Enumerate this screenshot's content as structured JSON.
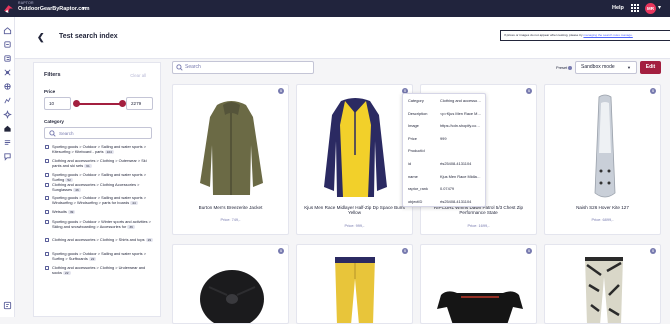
{
  "topbar": {
    "workspace_sub": "RAPTOR",
    "workspace_name": "OutdoorGearByRaptor.com",
    "help_label": "Help",
    "avatar_initials": "MR",
    "accent_color": "#a31f3f"
  },
  "sidebar": {
    "icons": [
      "home-icon",
      "layers-icon",
      "index-icon",
      "tools-icon",
      "merchandising-icon",
      "analytics-icon",
      "ai-icon",
      "shop-icon",
      "rules-icon",
      "chat-icon"
    ],
    "footer_icon": "help-icon"
  },
  "header": {
    "back_icon": "arrow-left-icon",
    "title": "Test search index",
    "notice_text": "If prices or images do not appear when testing, please try ",
    "notice_link": "managing the search rules manage."
  },
  "filters": {
    "title": "Filters",
    "clear_label": "Clear all",
    "price_label": "Price",
    "price_min": "10",
    "price_max": "2279",
    "category_label": "Category",
    "category_search_placeholder": "Search",
    "categories": [
      {
        "label": "Sporting goods > Outdoor > Sailing and water sports > Kitesurfing > Kiteboard - parts",
        "count": "104"
      },
      {
        "label": "Clothing and accessories > Clothing > Outerwear > Ski pants and ski sets",
        "count": "61"
      },
      {
        "label": "Sporting goods > Outdoor > Sailing and water sports > Surfing",
        "count": "52"
      },
      {
        "label": "Clothing and accessories > Clothing Accessories > Sunglasses",
        "count": "46"
      },
      {
        "label": "Sporting goods > Outdoor > Sailing and water sports > Windsurfing > Windsurfing > parts for boards",
        "count": "44"
      },
      {
        "label": "Wetsuits",
        "count": "39"
      },
      {
        "label": "Sporting goods > Outdoor > Winter sports and activities > Skiing and snowboarding > Accessories for",
        "count": "36"
      },
      {
        "label": "Clothing and accessories > Clothing > Shirts and tops",
        "count": "29"
      },
      {
        "label": "Sporting goods > Outdoor > Sailing and water sports > Surfing > Surfboards",
        "count": "22"
      },
      {
        "label": "Clothing and accessories > Clothing > Underwear and socks",
        "count": "22"
      }
    ]
  },
  "toolbar": {
    "search_placeholder": "Search",
    "preset_label": "Preset",
    "mode_value": "Sandbox mode",
    "edit_label": "Edit"
  },
  "products": [
    {
      "name": "Burton Men's Breezerite Jacket",
      "price": "Price: 749,-"
    },
    {
      "name": "Kjus Men Race Midlayer Half-Zip Dp Space Bumt Yellow",
      "price": "Price: 999,-"
    },
    {
      "name": "RIPCURL Wmns Dawn Patrol 5/3 Chest Zip Performance State",
      "price": "Price: 1699,-"
    },
    {
      "name": "Naish S26 Hover Kite 127",
      "price": "Price: 6899,-"
    },
    {
      "name": "",
      "price": ""
    },
    {
      "name": "",
      "price": ""
    },
    {
      "name": "",
      "price": ""
    },
    {
      "name": "",
      "price": ""
    }
  ],
  "tooltip": {
    "rows": [
      {
        "key": "Category",
        "value": "Clothing and accessories > Clothi..."
      },
      {
        "key": "Description",
        "value": "<p>Kjus Men Race Midlayer Half..."
      },
      {
        "key": "Image",
        "value": "https://cdn.shopify.com/s/files/1..."
      },
      {
        "key": "Price",
        "value": "999"
      },
      {
        "key": "ProductId",
        "value": ""
      },
      {
        "key": "id",
        "value": "rts25408-4131104"
      },
      {
        "key": "name",
        "value": "Kjus Men Race Midlayer Half-Zip..."
      },
      {
        "key": "raptor_rank",
        "value": "0.07479"
      },
      {
        "key": "objectID",
        "value": "rts25408-4131104"
      }
    ]
  }
}
